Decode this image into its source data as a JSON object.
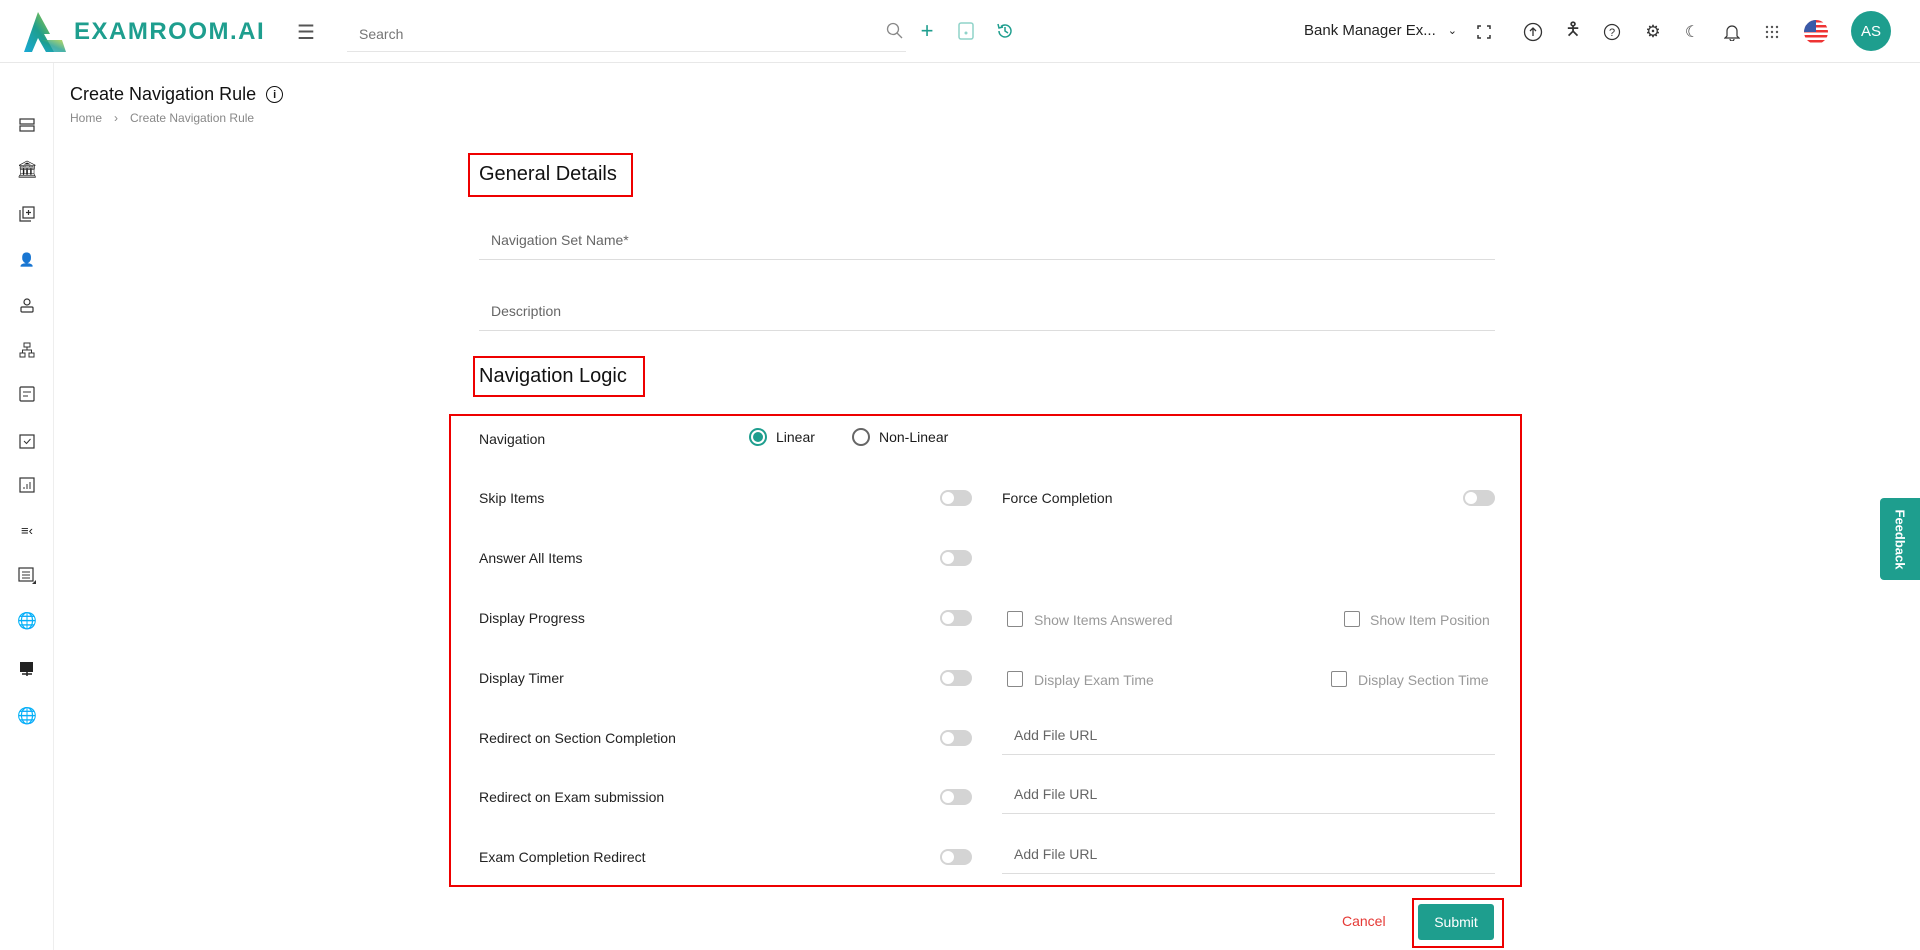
{
  "header": {
    "brand": "EXAMROOM.AI",
    "search_placeholder": "Search",
    "exam_selector": "Bank Manager Ex...",
    "avatar_initials": "AS"
  },
  "page": {
    "title": "Create Navigation Rule",
    "breadcrumb": [
      "Home",
      "Create Navigation Rule"
    ]
  },
  "general": {
    "heading": "General Details",
    "name_placeholder": "Navigation Set Name*",
    "description_placeholder": "Description"
  },
  "logic": {
    "heading": "Navigation Logic",
    "navigation_label": "Navigation",
    "radio_linear": "Linear",
    "radio_nonlinear": "Non-Linear",
    "selected": "Linear",
    "skip_items": "Skip Items",
    "force_completion": "Force Completion",
    "answer_all": "Answer All Items",
    "display_progress": "Display Progress",
    "show_items_answered": "Show Items Answered",
    "show_item_position": "Show Item Position",
    "display_timer": "Display Timer",
    "display_exam_time": "Display Exam Time",
    "display_section_time": "Display Section Time",
    "redirect_section": "Redirect on Section Completion",
    "redirect_exam": "Redirect on Exam submission",
    "exam_completion_redirect": "Exam Completion Redirect",
    "url_placeholder": "Add File URL"
  },
  "actions": {
    "cancel": "Cancel",
    "submit": "Submit"
  },
  "feedback": "Feedback",
  "colors": {
    "accent": "#1e9e8e",
    "red": "#e00000"
  }
}
